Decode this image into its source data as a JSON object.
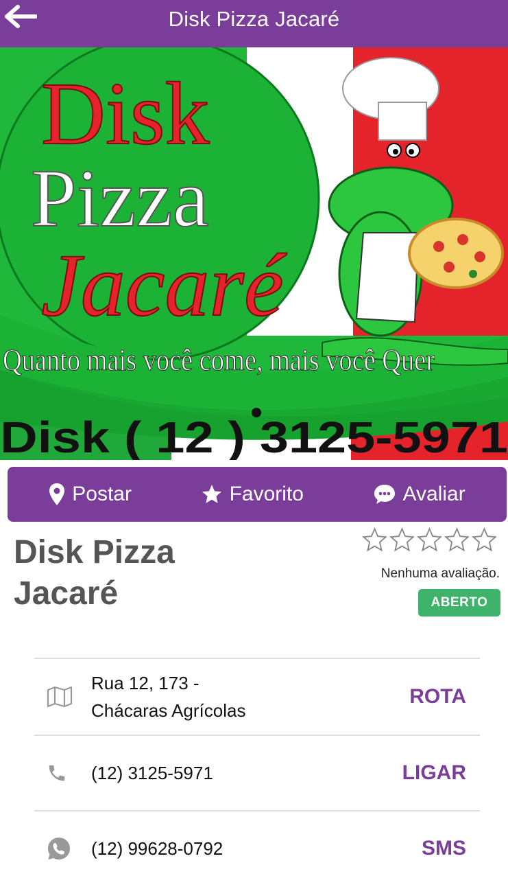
{
  "header": {
    "title": "Disk Pizza Jacaré",
    "back_icon": "arrow-left-icon"
  },
  "banner": {
    "line1": "Disk",
    "line2": "Pizza",
    "line3": "Jacaré",
    "slogan": "Quanto mais você come, mais você Quer",
    "phone_text": "Disk ( 12 ) 3125-5971",
    "colors": {
      "green": "#1fb83a",
      "red": "#e5232b",
      "white": "#ffffff"
    }
  },
  "actions": [
    {
      "label": "Postar",
      "icon": "map-pin-icon"
    },
    {
      "label": "Favorito",
      "icon": "star-icon"
    },
    {
      "label": "Avaliar",
      "icon": "chat-bubble-icon"
    }
  ],
  "business": {
    "name": "Disk Pizza Jacaré",
    "rating_stars": 0,
    "rating_max": 5,
    "rating_text": "Nenhuma avaliação.",
    "status": "ABERTO"
  },
  "contacts": {
    "address": {
      "line1": "Rua 12, 173 -",
      "line2": "Chácaras Agrícolas",
      "action": "ROTA",
      "icon": "map-icon"
    },
    "phone": {
      "value": "(12) 3125-5971",
      "action": "LIGAR",
      "icon": "phone-icon"
    },
    "whatsapp": {
      "value": "(12) 99628-0792",
      "action": "SMS",
      "icon": "whatsapp-icon"
    }
  },
  "theme": {
    "primary": "#7a3d99",
    "success": "#3fb36b"
  }
}
